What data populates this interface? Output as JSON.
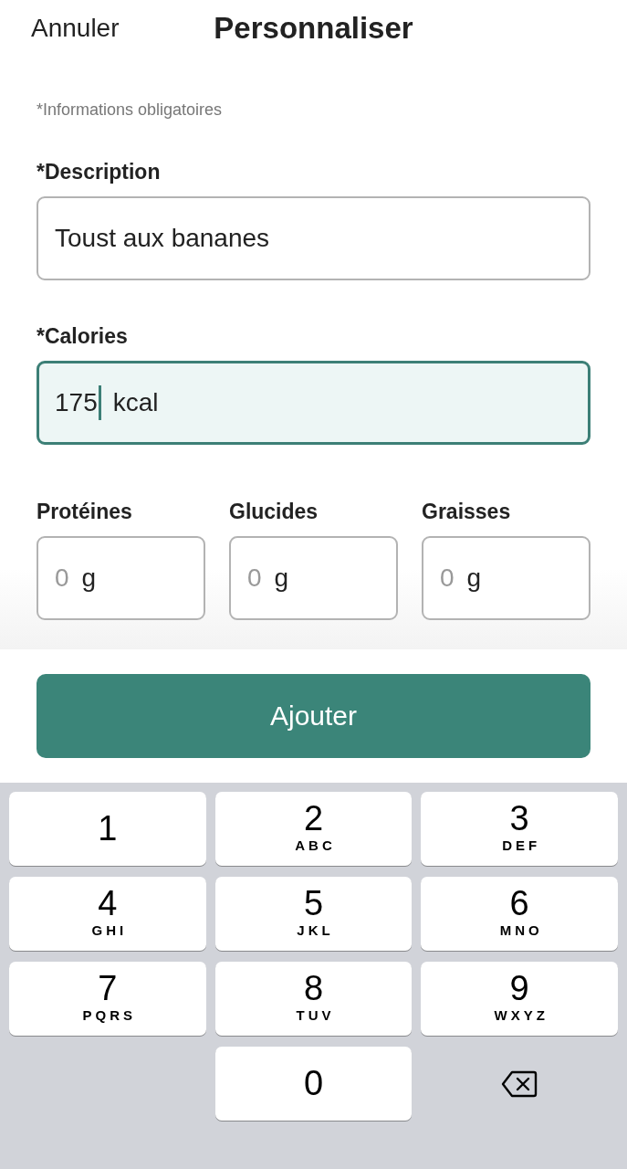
{
  "header": {
    "cancel": "Annuler",
    "title": "Personnaliser"
  },
  "note": "*Informations obligatoires",
  "fields": [
    {
      "label": "*Description",
      "value": "Toust aux bananes",
      "focused": false
    },
    {
      "label": "*Calories",
      "value": "175",
      "unit": "kcal",
      "focused": true
    }
  ],
  "macros": [
    {
      "label": "Protéines",
      "placeholder": "0",
      "unit": "g"
    },
    {
      "label": "Glucides",
      "placeholder": "0",
      "unit": "g"
    },
    {
      "label": "Graisses",
      "placeholder": "0",
      "unit": "g"
    }
  ],
  "add_button": "Ajouter",
  "keypad": [
    {
      "kind": "digit",
      "digit": "1"
    },
    {
      "kind": "digit",
      "digit": "2",
      "letters": "ABC"
    },
    {
      "kind": "digit",
      "digit": "3",
      "letters": "DEF"
    },
    {
      "kind": "digit",
      "digit": "4",
      "letters": "GHI"
    },
    {
      "kind": "digit",
      "digit": "5",
      "letters": "JKL"
    },
    {
      "kind": "digit",
      "digit": "6",
      "letters": "MNO"
    },
    {
      "kind": "digit",
      "digit": "7",
      "letters": "PQRS"
    },
    {
      "kind": "digit",
      "digit": "8",
      "letters": "TUV"
    },
    {
      "kind": "digit",
      "digit": "9",
      "letters": "WXYZ"
    },
    {
      "kind": "digit",
      "digit": "0"
    },
    {
      "kind": "delete"
    }
  ]
}
